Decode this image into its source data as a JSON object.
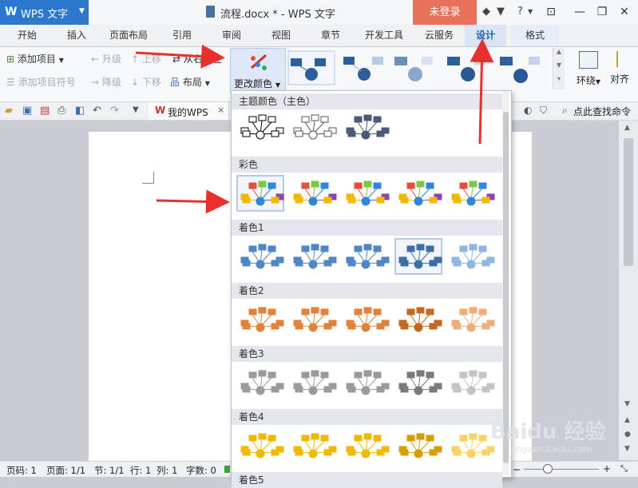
{
  "titlebar": {
    "app_name": "WPS 文字",
    "doc_title": "流程.docx * - WPS 文字",
    "login_label": "未登录",
    "help_label": "?",
    "minimize": "—",
    "restore": "❐",
    "close": "✕"
  },
  "tabs": [
    "开始",
    "插入",
    "页面布局",
    "引用",
    "审阅",
    "视图",
    "章节",
    "开发工具",
    "云服务",
    "设计",
    "格式"
  ],
  "active_tab": "设计",
  "ribbon": {
    "add_item": "添加项目",
    "add_bullet": "添加项目符号",
    "promote": "升级",
    "demote": "降级",
    "move_up": "上移",
    "move_down": "下移",
    "right_to_left": "从右至左",
    "layout": "布局",
    "change_color": "更改颜色",
    "wrap": "环绕",
    "align": "对齐"
  },
  "quickbar": {
    "tab_label": "我的WPS",
    "search_cmd": "点此查找命令"
  },
  "dropdown": {
    "sections": [
      {
        "title": "主题颜色（主色）",
        "palette": [
          "#000000",
          "#555555",
          "#4a5a78"
        ]
      },
      {
        "title": "彩色",
        "palette": [
          "#4e8fd6",
          "#e27a3a",
          "#b8691a",
          "#7ac943",
          "#29a7c7"
        ]
      },
      {
        "title": "着色1",
        "palette": [
          "#4f86c6",
          "#4f86c6",
          "#4f86c6",
          "#3e6ea6",
          "#8fb6e0"
        ]
      },
      {
        "title": "着色2",
        "palette": [
          "#e2823a",
          "#e2823a",
          "#e2823a",
          "#c5681f",
          "#f0ad79"
        ]
      },
      {
        "title": "着色3",
        "palette": [
          "#9a9a9a",
          "#9a9a9a",
          "#9a9a9a",
          "#7a7a7a",
          "#c4c4c4"
        ]
      },
      {
        "title": "着色4",
        "palette": [
          "#f0b800",
          "#f0b800",
          "#f0b800",
          "#d39e00",
          "#f7d266"
        ]
      },
      {
        "title": "着色5",
        "palette": []
      }
    ]
  },
  "status": {
    "page": "页码: 1",
    "pages": "页面: 1/1",
    "section": "节: 1/1",
    "row": "行: 1",
    "col": "列: 1",
    "words": "字数: 0"
  },
  "watermark": {
    "main": "Baidu 经验",
    "sub": "jingyan.baidu.com"
  },
  "colors": {
    "accent": "#2b78d0",
    "login": "#e9705a",
    "arrow": "#e8312f"
  }
}
